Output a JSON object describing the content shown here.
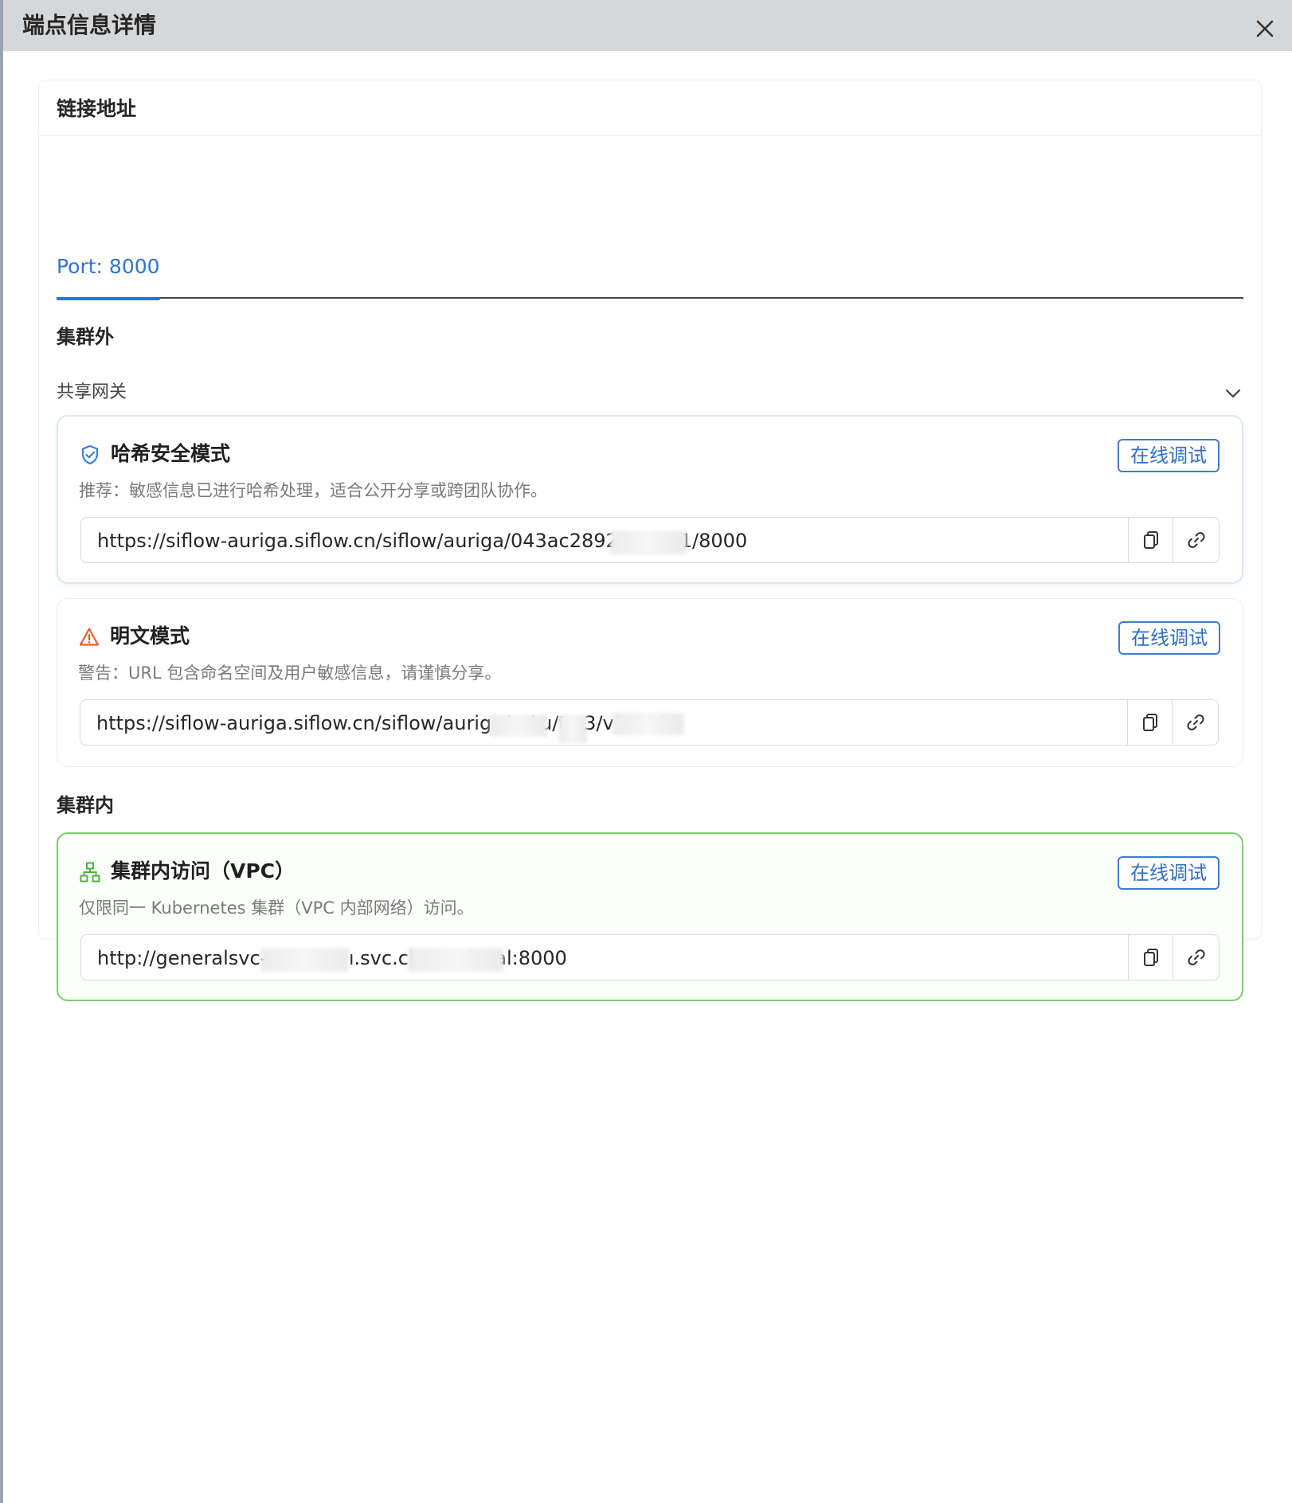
{
  "dialog": {
    "title": "端点信息详情"
  },
  "card": {
    "title": "链接地址",
    "tab_label": "Port: 8000"
  },
  "outside": {
    "heading": "集群外",
    "gateway_label": "共享网关",
    "secure": {
      "title": "哈希安全模式",
      "desc": "推荐：敏感信息已进行哈希处理，适合公开分享或跨团队协作。",
      "debug_label": "在线调试",
      "url": "https://siflow-auriga.siflow.cn/siflow/auriga/043ac28921/t                    3/v1/8000"
    },
    "plain": {
      "title": "明文模式",
      "desc": "警告：URL 包含命名空间及用户敏感信息，请谨慎分享。",
      "debug_label": "在线调试",
      "url": "https://siflow-auriga.siflow.cn/siflow/auriga/a              /      u/te                 3/v1/8000"
    }
  },
  "inside": {
    "heading": "集群内",
    "vpc": {
      "title": "集群内访问（VPC）",
      "desc": "仅限同一 Kubernetes 集群（VPC 内部网络）访问。",
      "debug_label": "在线调试",
      "url": "http://generalsvc-t                    -v1.t-a                        ı.svc.cluster.local:8000"
    }
  },
  "colors": {
    "accent": "#2f74d0",
    "secure_icon": "#3b7dd8",
    "warning_icon": "#e0622f",
    "vpc_icon": "#52b043",
    "vpc_border": "#7ccc6e"
  },
  "icons": {
    "close": "close-icon",
    "chevron": "chevron-down-icon",
    "secure": "shield-check-icon",
    "warning": "warning-triangle-icon",
    "vpc": "network-tree-icon",
    "copy": "copy-icon",
    "link": "link-icon"
  }
}
